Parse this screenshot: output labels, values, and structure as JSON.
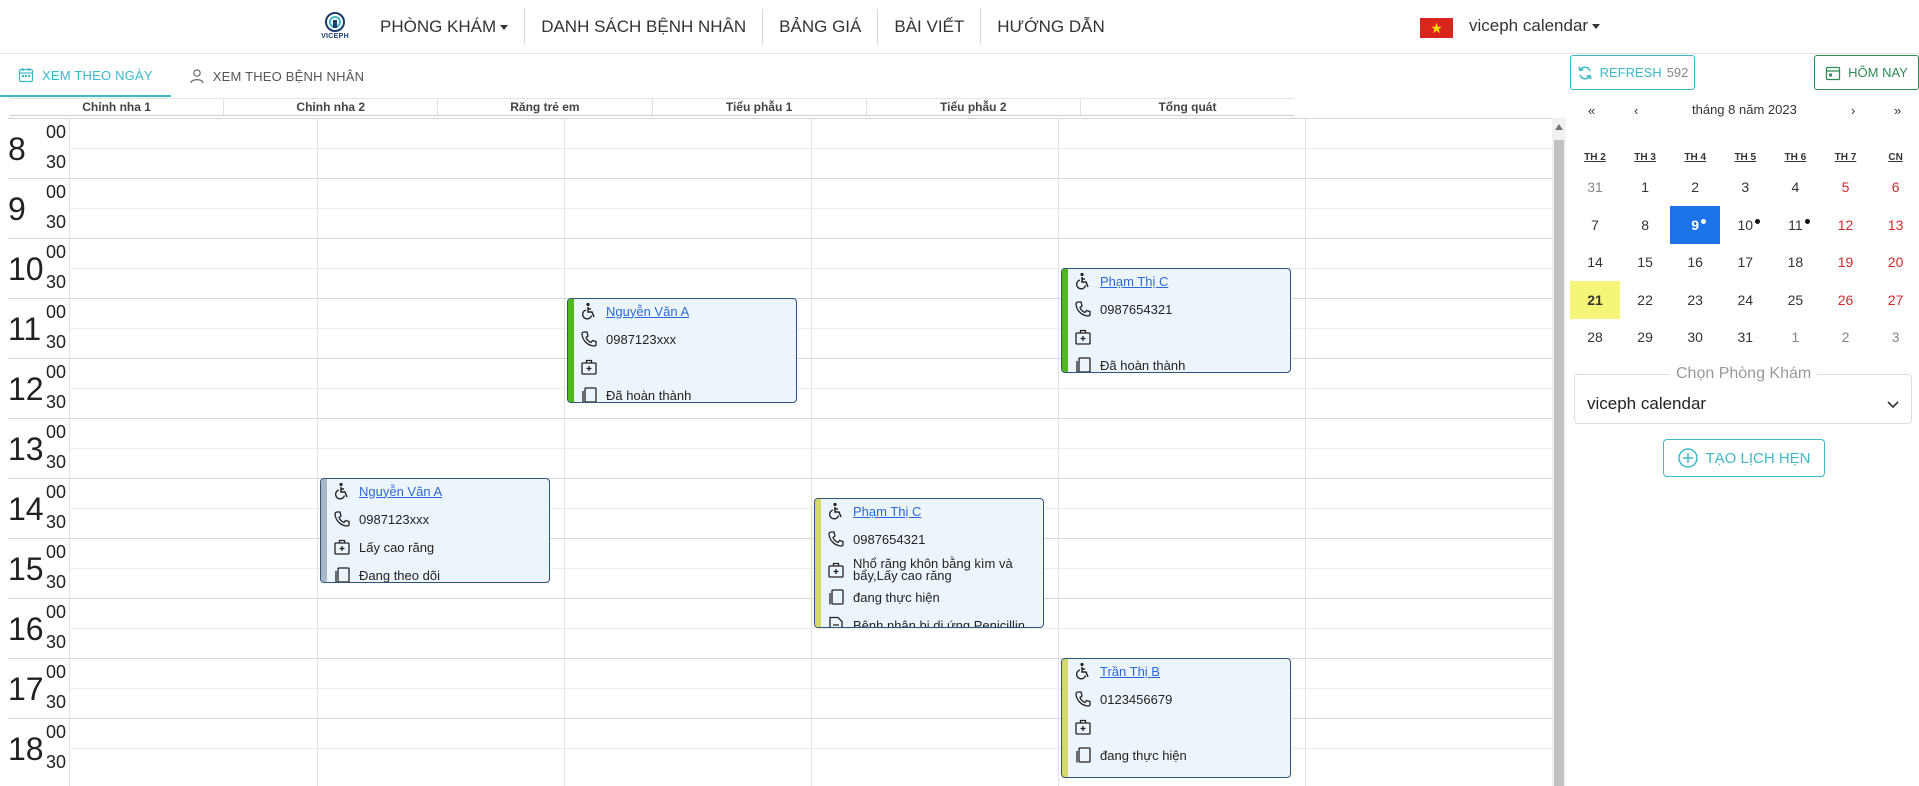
{
  "brand": {
    "logo_text": "VICEPH"
  },
  "nav": {
    "items": [
      "PHÒNG KHÁM",
      "DANH SÁCH BỆNH NHÂN",
      "BẢNG GIÁ",
      "BÀI VIẾT",
      "HƯỚNG DẪN"
    ],
    "language_flag_icon": "vietnam-flag-icon",
    "user_menu_label": "viceph calendar"
  },
  "view_tabs": {
    "by_day": "XEM THEO NGÀY",
    "by_patient": "XEM THEO BỆNH NHÂN",
    "active": "by_day"
  },
  "toolbar": {
    "refresh_label": "REFRESH",
    "refresh_count": "592",
    "today_label": "HÔM NAY"
  },
  "rooms": [
    "Chỉnh nha 1",
    "Chỉnh nha 2",
    "Răng trẻ em",
    "Tiểu phẫu 1",
    "Tiểu phẫu 2",
    "Tổng quát"
  ],
  "time_grid": {
    "hours": [
      "8",
      "9",
      "10",
      "11",
      "12",
      "13",
      "14",
      "15",
      "16",
      "17",
      "18"
    ],
    "minute_marks": [
      "00",
      "30"
    ]
  },
  "appointments": [
    {
      "room": "Răng trẻ em",
      "start": "11:00",
      "end": "12:45",
      "patient": "Nguyễn Văn A",
      "phone": "0987123xxx",
      "service": "",
      "status": "Đã hoàn thành",
      "note": "",
      "status_color": "#4fb81c"
    },
    {
      "room": "Tiểu phẫu 2",
      "start": "10:30",
      "end": "12:15",
      "patient": "Phạm Thị C",
      "phone": "0987654321",
      "service": "",
      "status": "Đã hoàn thành",
      "note": "",
      "status_color": "#4fb81c"
    },
    {
      "room": "Chỉnh nha 2",
      "start": "14:00",
      "end": "15:45",
      "patient": "Nguyễn Văn A",
      "phone": "0987123xxx",
      "service": "Lấy cao răng",
      "status": "Đang theo dõi",
      "note": "",
      "status_color": "#a9b6c4"
    },
    {
      "room": "Tiểu phẫu 1",
      "start": "14:20",
      "end": "16:30",
      "patient": "Phạm Thị C",
      "phone": "0987654321",
      "service": "Nhổ răng khôn bằng kìm và bẩy,Lấy cao răng",
      "status": "đang thực hiện",
      "note": "Bệnh nhân bị dị ứng Penicillin",
      "status_color": "#d6d86a"
    },
    {
      "room": "Tiểu phẫu 2",
      "start": "17:00",
      "end": "19:00",
      "patient": "Trần Thị B",
      "phone": "0123456679",
      "service": "",
      "status": "đang thực hiện",
      "note": "",
      "status_color": "#d6d86a"
    }
  ],
  "mini_calendar": {
    "title": "tháng 8 năm 2023",
    "nav": {
      "prev_year": "«",
      "prev_month": "‹",
      "next_month": "›",
      "next_year": "»"
    },
    "weekdays": [
      "TH 2",
      "TH 3",
      "TH 4",
      "TH 5",
      "TH 6",
      "TH 7",
      "CN"
    ],
    "weeks": [
      [
        "31",
        "1",
        "2",
        "3",
        "4",
        "5",
        "6"
      ],
      [
        "7",
        "8",
        "9",
        "10",
        "11",
        "12",
        "13"
      ],
      [
        "14",
        "15",
        "16",
        "17",
        "18",
        "19",
        "20"
      ],
      [
        "21",
        "22",
        "23",
        "24",
        "25",
        "26",
        "27"
      ],
      [
        "28",
        "29",
        "30",
        "31",
        "1",
        "2",
        "3"
      ]
    ],
    "selected_day": "9",
    "today_day": "21",
    "days_with_events": [
      "9",
      "10",
      "11"
    ],
    "weekend_color": "#d42a2a",
    "selected_color": "#1a73e8",
    "today_color": "#f5f57a"
  },
  "clinic_select": {
    "legend": "Chọn Phòng Khám",
    "value": "viceph calendar"
  },
  "create_button_label": "TẠO LỊCH HẸN"
}
